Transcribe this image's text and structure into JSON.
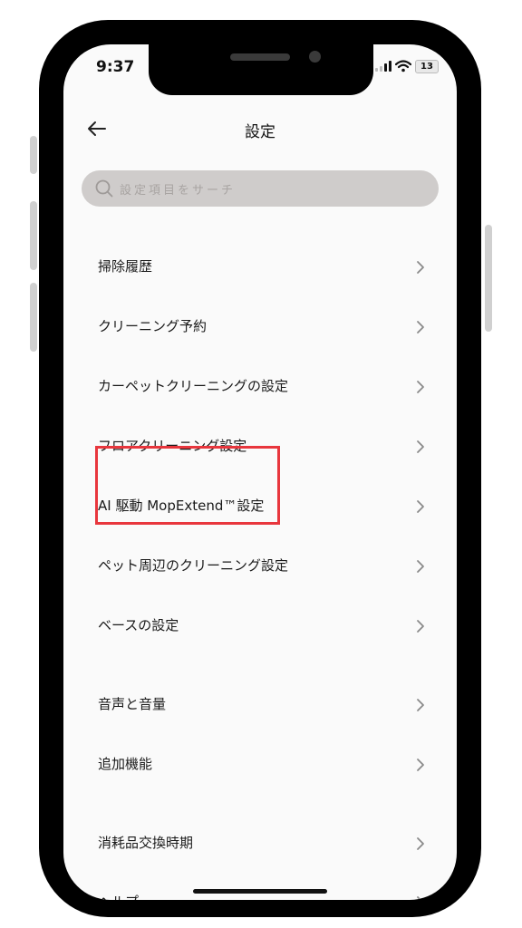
{
  "status_bar": {
    "time": "9:37",
    "battery": "13"
  },
  "header": {
    "title": "設定",
    "back_icon": "arrow-left-icon"
  },
  "search": {
    "placeholder": "設定項目をサーチ",
    "icon": "search-icon"
  },
  "menu": {
    "items": [
      {
        "label": "掃除履歴"
      },
      {
        "label": "クリーニング予約"
      },
      {
        "label": "カーペットクリーニングの設定"
      },
      {
        "label": "フロアクリーニング設定"
      },
      {
        "label": "AI 駆動 MopExtend™設定"
      },
      {
        "label": "ペット周辺のクリーニング設定"
      },
      {
        "label": "ベースの設定"
      },
      {
        "label": "音声と音量"
      },
      {
        "label": "追加機能"
      },
      {
        "label": "消耗品交換時期"
      },
      {
        "label": "ヘルプ"
      }
    ],
    "chevron_icon": "chevron-right-icon"
  },
  "colors": {
    "highlight": "#e8363d",
    "search_bg": "#cfcccb",
    "screen_bg": "#fafafa"
  }
}
